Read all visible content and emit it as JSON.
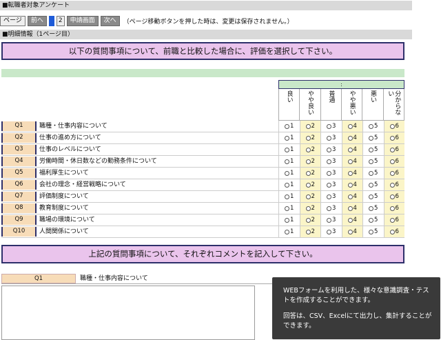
{
  "section1": {
    "title": "■転職者対象アンケート"
  },
  "pager": {
    "page_label": "ページ",
    "prev_label": "前へ",
    "page_number": "2",
    "apply_label": "申請画面",
    "next_label": "次へ",
    "note": "（ページ移動ボタンを押した時は、変更は保存されません。）"
  },
  "section2": {
    "title": "■明細情報（1ページ目）"
  },
  "banner1": "以下の質問事項について、前職と比較した場合に、評価を選択して下さい。",
  "matrix": {
    "header": ":",
    "scale": [
      "良い",
      "やや良い",
      "普通",
      "やや悪い",
      "悪い",
      "分からない"
    ],
    "options": [
      "1",
      "2",
      "3",
      "4",
      "5",
      "6"
    ],
    "questions": [
      {
        "id": "Q1",
        "text": "職種・仕事内容について"
      },
      {
        "id": "Q2",
        "text": "仕事の進め方について"
      },
      {
        "id": "Q3",
        "text": "仕事のレベルについて"
      },
      {
        "id": "Q4",
        "text": "労働時間・休日数などの勤務条件について"
      },
      {
        "id": "Q5",
        "text": "福利厚生について"
      },
      {
        "id": "Q6",
        "text": "会社の理念・経営戦略について"
      },
      {
        "id": "Q7",
        "text": "評価制度について"
      },
      {
        "id": "Q8",
        "text": "教育制度について"
      },
      {
        "id": "Q9",
        "text": "職場の環境について"
      },
      {
        "id": "Q10",
        "text": "人間関係について"
      }
    ]
  },
  "banner2": "上記の質問事項について、それぞれコメントを記入して下さい。",
  "comment": {
    "id": "Q1",
    "text": "職種・仕事内容について",
    "value": ""
  },
  "callout": {
    "line1": "WEBフォームを利用した、様々な意識調査・テストを作成することができます。",
    "line2": "回答は、CSV、Excelにて出力し、集計することができます。"
  },
  "colors": {
    "banner_bg": "#eac4ec",
    "banner_border": "#2d2f6a",
    "green_bar": "#c9e8c9",
    "qid_bg": "#f7dcb8",
    "callout_bg": "#3a3a3a"
  }
}
